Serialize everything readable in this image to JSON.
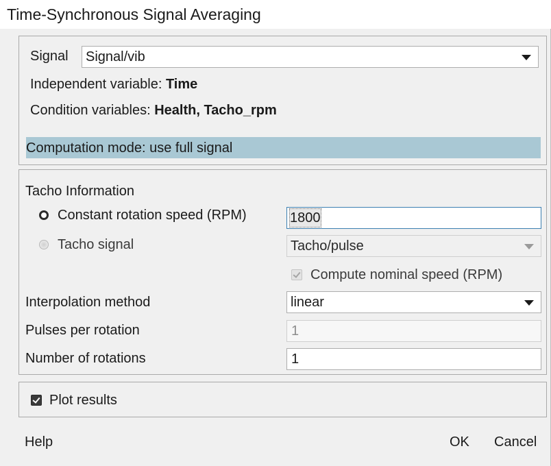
{
  "window": {
    "title": "Time-Synchronous Signal Averaging"
  },
  "signal_panel": {
    "signal_label": "Signal",
    "signal_value": "Signal/vib",
    "independent_label": "Independent variable: ",
    "independent_value": "Time",
    "condition_label": "Condition variables: ",
    "condition_value": "Health, Tacho_rpm",
    "computation_mode": "Computation mode: use full signal"
  },
  "tacho_panel": {
    "heading": "Tacho Information",
    "constant_speed_label": "Constant rotation speed (RPM)",
    "constant_speed_value": "1800",
    "constant_speed_selected": true,
    "tacho_signal_label": "Tacho signal",
    "tacho_signal_value": "Tacho/pulse",
    "compute_nominal_label": "Compute nominal speed (RPM)",
    "compute_nominal_checked": true,
    "interpolation_label": "Interpolation method",
    "interpolation_value": "linear",
    "pulses_label": "Pulses per rotation",
    "pulses_value": "1",
    "rotations_label": "Number of rotations",
    "rotations_value": "1"
  },
  "plot_panel": {
    "plot_results_label": "Plot results",
    "plot_results_checked": true
  },
  "footer": {
    "help_label": "Help",
    "ok_label": "OK",
    "cancel_label": "Cancel"
  },
  "colors": {
    "mode_bar": "#a9c8d4",
    "dialog_bg": "#f0f0f0"
  }
}
